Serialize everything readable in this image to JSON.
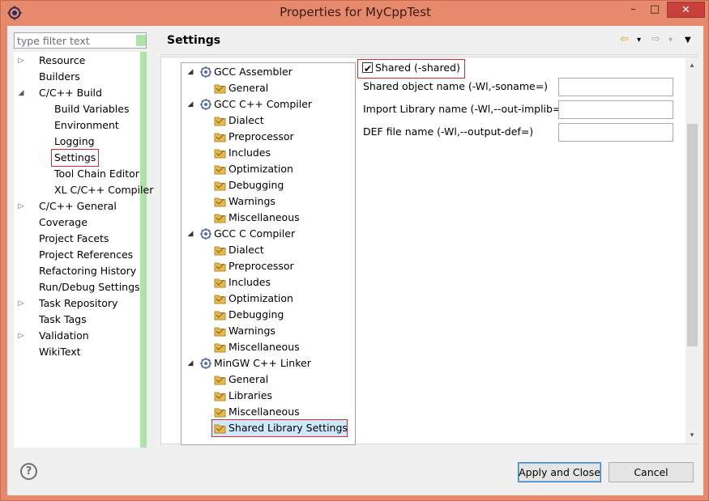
{
  "window": {
    "title": "Properties for MyCppTest",
    "min_glyph": "–",
    "max_glyph": "□",
    "close_glyph": "✕"
  },
  "filter": {
    "placeholder": "type filter text"
  },
  "nav": {
    "items": [
      {
        "label": "Resource",
        "arrow": "▷"
      },
      {
        "label": "Builders",
        "arrow": ""
      },
      {
        "label": "C/C++ Build",
        "arrow": "◢"
      },
      {
        "label": "Build Variables",
        "arrow": ""
      },
      {
        "label": "Environment",
        "arrow": ""
      },
      {
        "label": "Logging",
        "arrow": ""
      },
      {
        "label": "Settings",
        "arrow": ""
      },
      {
        "label": "Tool Chain Editor",
        "arrow": ""
      },
      {
        "label": "XL C/C++ Compiler",
        "arrow": ""
      },
      {
        "label": "C/C++ General",
        "arrow": "▷"
      },
      {
        "label": "Coverage",
        "arrow": ""
      },
      {
        "label": "Project Facets",
        "arrow": ""
      },
      {
        "label": "Project References",
        "arrow": ""
      },
      {
        "label": "Refactoring History",
        "arrow": ""
      },
      {
        "label": "Run/Debug Settings",
        "arrow": ""
      },
      {
        "label": "Task Repository",
        "arrow": "▷"
      },
      {
        "label": "Task Tags",
        "arrow": ""
      },
      {
        "label": "Validation",
        "arrow": "▷"
      },
      {
        "label": "WikiText",
        "arrow": ""
      }
    ]
  },
  "header": {
    "title": "Settings",
    "back_glyph": "⇦",
    "forward_glyph": "⇨",
    "dropdown_glyph": "▾",
    "menu_glyph": "▼"
  },
  "tree": {
    "items": [
      {
        "label": "GCC Assembler",
        "type": "tool",
        "expand": "◢"
      },
      {
        "label": "General",
        "type": "option"
      },
      {
        "label": "GCC C++ Compiler",
        "type": "tool",
        "expand": "◢"
      },
      {
        "label": "Dialect",
        "type": "option"
      },
      {
        "label": "Preprocessor",
        "type": "option"
      },
      {
        "label": "Includes",
        "type": "option"
      },
      {
        "label": "Optimization",
        "type": "option"
      },
      {
        "label": "Debugging",
        "type": "option"
      },
      {
        "label": "Warnings",
        "type": "option"
      },
      {
        "label": "Miscellaneous",
        "type": "option"
      },
      {
        "label": "GCC C Compiler",
        "type": "tool",
        "expand": "◢"
      },
      {
        "label": "Dialect",
        "type": "option"
      },
      {
        "label": "Preprocessor",
        "type": "option"
      },
      {
        "label": "Includes",
        "type": "option"
      },
      {
        "label": "Optimization",
        "type": "option"
      },
      {
        "label": "Debugging",
        "type": "option"
      },
      {
        "label": "Warnings",
        "type": "option"
      },
      {
        "label": "Miscellaneous",
        "type": "option"
      },
      {
        "label": "MinGW C++ Linker",
        "type": "tool",
        "expand": "◢"
      },
      {
        "label": "General",
        "type": "option"
      },
      {
        "label": "Libraries",
        "type": "option"
      },
      {
        "label": "Miscellaneous",
        "type": "option"
      },
      {
        "label": "Shared Library Settings",
        "type": "option",
        "selected": true
      }
    ]
  },
  "form": {
    "shared_checkbox": {
      "label": "Shared (-shared)",
      "checked": true,
      "mark": "✔"
    },
    "fields": [
      {
        "label": "Shared object name (-Wl,-soname=)",
        "value": ""
      },
      {
        "label": "Import Library name (-Wl,--out-implib=)",
        "value": ""
      },
      {
        "label": "DEF file name (-Wl,--output-def=)",
        "value": ""
      }
    ]
  },
  "scroll": {
    "up_glyph": "▴",
    "down_glyph": "▾"
  },
  "footer": {
    "help_glyph": "?",
    "apply_label": "Apply and Close",
    "cancel_label": "Cancel"
  },
  "colors": {
    "titlebar": "#e6896d",
    "close_button": "#c7403a",
    "selection": "#cde8ff",
    "highlight_box": "#d82a2a",
    "sash": "#aee4a8"
  }
}
